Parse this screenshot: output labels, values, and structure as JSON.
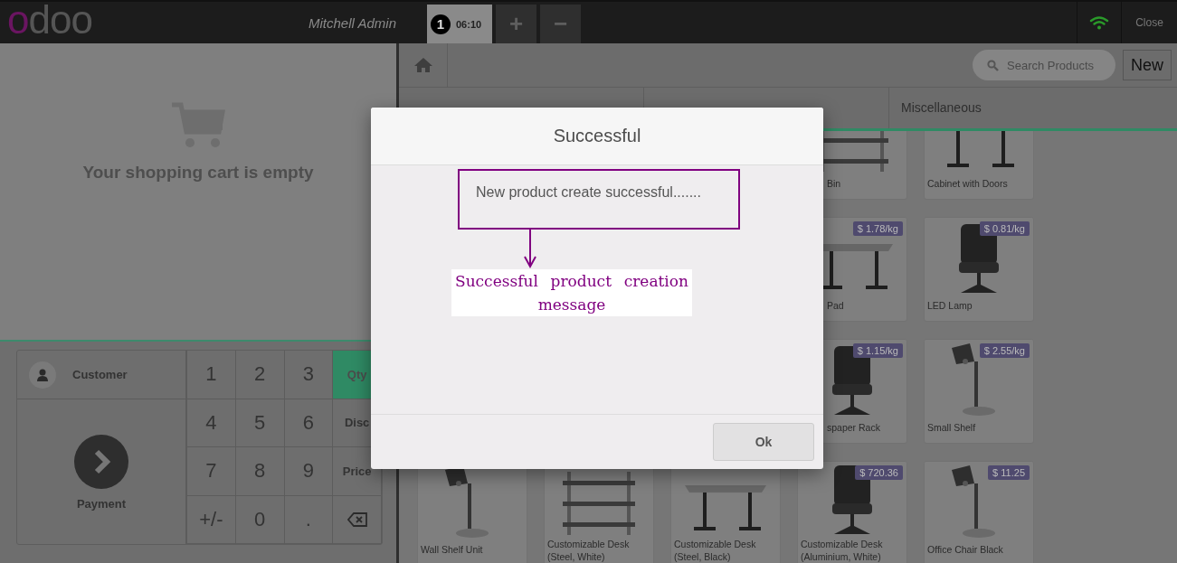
{
  "header": {
    "logo": "odoo",
    "user": "Mitchell Admin",
    "orders": [
      {
        "number": "1",
        "time": "06:10",
        "selected": true
      }
    ],
    "add_order": "+",
    "remove_order": "−",
    "connected": true,
    "close": "Close"
  },
  "cart": {
    "empty_message": "Your shopping cart is empty"
  },
  "numpad": {
    "customer": "Customer",
    "payment": "Payment",
    "keys": [
      "1",
      "2",
      "3",
      "4",
      "5",
      "6",
      "7",
      "8",
      "9",
      "+/-",
      "0",
      "."
    ],
    "modes": [
      {
        "label": "Qty",
        "selected": true
      },
      {
        "label": "Disc",
        "selected": false
      },
      {
        "label": "Price",
        "selected": false
      }
    ]
  },
  "products": {
    "search": {
      "placeholder": "Search Products"
    },
    "new_button": "New",
    "categories": [
      "Miscellaneous"
    ],
    "rows": [
      {
        "cards": [
          {
            "name": "Bin",
            "partly_hidden": true
          },
          {
            "name": "Cabinet with Doors"
          }
        ]
      },
      {
        "cards": [
          {
            "name": "Pad",
            "price": "$ 1.78/kg",
            "partly_hidden": true
          },
          {
            "name": "LED Lamp",
            "price": "$ 0.81/kg"
          }
        ]
      },
      {
        "cards": [
          {
            "name": "spaper Rack",
            "price": "$ 1.15/kg",
            "partly_hidden": true
          },
          {
            "name": "Small Shelf",
            "price": "$ 2.55/kg"
          }
        ]
      },
      {
        "cards": [
          {
            "name": "Wall Shelf Unit"
          },
          {
            "name": "Customizable Desk\n(Steel, White)"
          },
          {
            "name": "Customizable Desk\n(Steel, Black)"
          },
          {
            "name": "Customizable Desk\n(Aluminium, White)",
            "price": "$ 720.36"
          },
          {
            "name": "Office Chair Black",
            "price": "$ 11.25"
          }
        ]
      }
    ]
  },
  "dialog": {
    "title": "Successful",
    "message": "New product create successful.......",
    "button": "Ok"
  },
  "annotation": {
    "label": "Successful product creation message"
  }
}
